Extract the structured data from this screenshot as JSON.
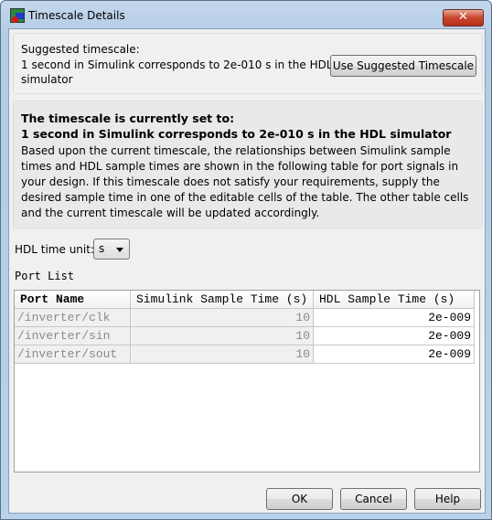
{
  "window": {
    "title": "Timescale Details",
    "close_icon": "close-icon"
  },
  "suggested": {
    "line1": "Suggested timescale:",
    "line2": "1 second in Simulink corresponds to 2e-010 s in the HDL",
    "line3": "simulator",
    "button": "Use Suggested Timescale"
  },
  "current": {
    "heading1": "The timescale is currently set to:",
    "heading2": "1 second in Simulink corresponds to 2e-010 s in the HDL simulator",
    "body": "Based upon the current timescale, the relationships between Simulink sample times and HDL sample times are shown in the following table for port signals in your design. If this timescale does not satisfy your requirements, supply the desired sample time in one of the editable cells of the table. The other table cells and the current timescale will be updated accordingly."
  },
  "unit": {
    "label": "HDL time unit:",
    "value": "s"
  },
  "ports": {
    "label": "Port List",
    "headers": [
      "Port Name",
      "Simulink Sample Time (s)",
      "HDL Sample Time (s)"
    ],
    "rows": [
      [
        "/inverter/clk",
        "10",
        "2e-009"
      ],
      [
        "/inverter/sin",
        "10",
        "2e-009"
      ],
      [
        "/inverter/sout",
        "10",
        "2e-009"
      ]
    ]
  },
  "buttons": {
    "ok": "OK",
    "cancel": "Cancel",
    "help": "Help"
  }
}
